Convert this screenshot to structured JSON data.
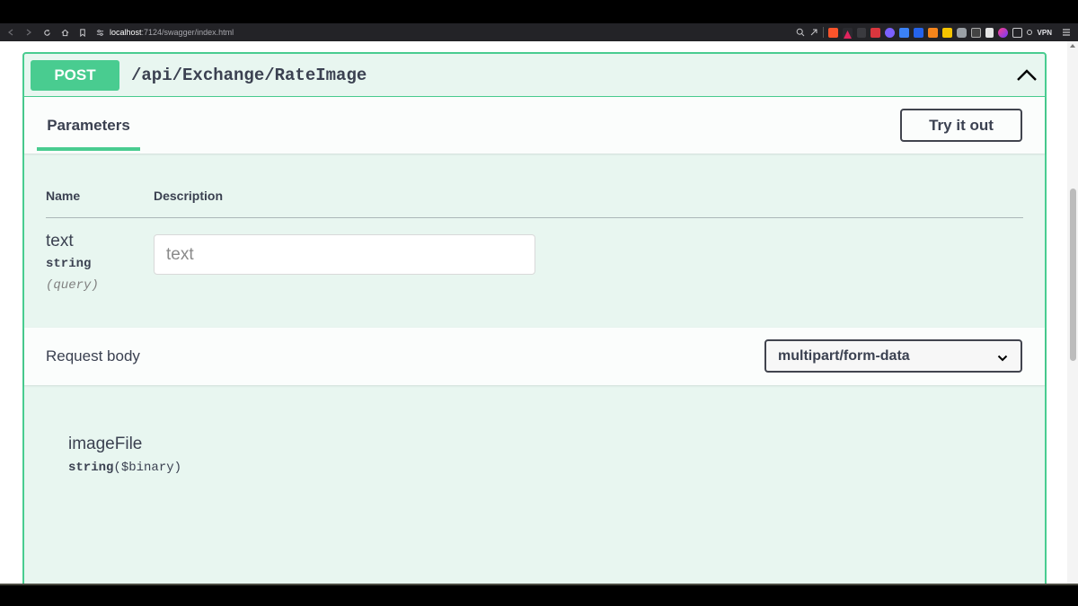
{
  "browser": {
    "url_host": "localhost",
    "url_path": ":7124/swagger/index.html",
    "vpn_label": "VPN"
  },
  "operation": {
    "method": "POST",
    "path": "/api/Exchange/RateImage",
    "method_color": "#49cc90"
  },
  "parameters_section": {
    "tab_label": "Parameters",
    "try_button_label": "Try it out",
    "columns": {
      "name": "Name",
      "description": "Description"
    },
    "params": [
      {
        "name": "text",
        "type": "string",
        "in": "(query)",
        "placeholder": "text"
      }
    ]
  },
  "request_body": {
    "title": "Request body",
    "content_type": "multipart/form-data",
    "fields": [
      {
        "name": "imageFile",
        "type": "string",
        "format": "($binary)"
      }
    ]
  }
}
